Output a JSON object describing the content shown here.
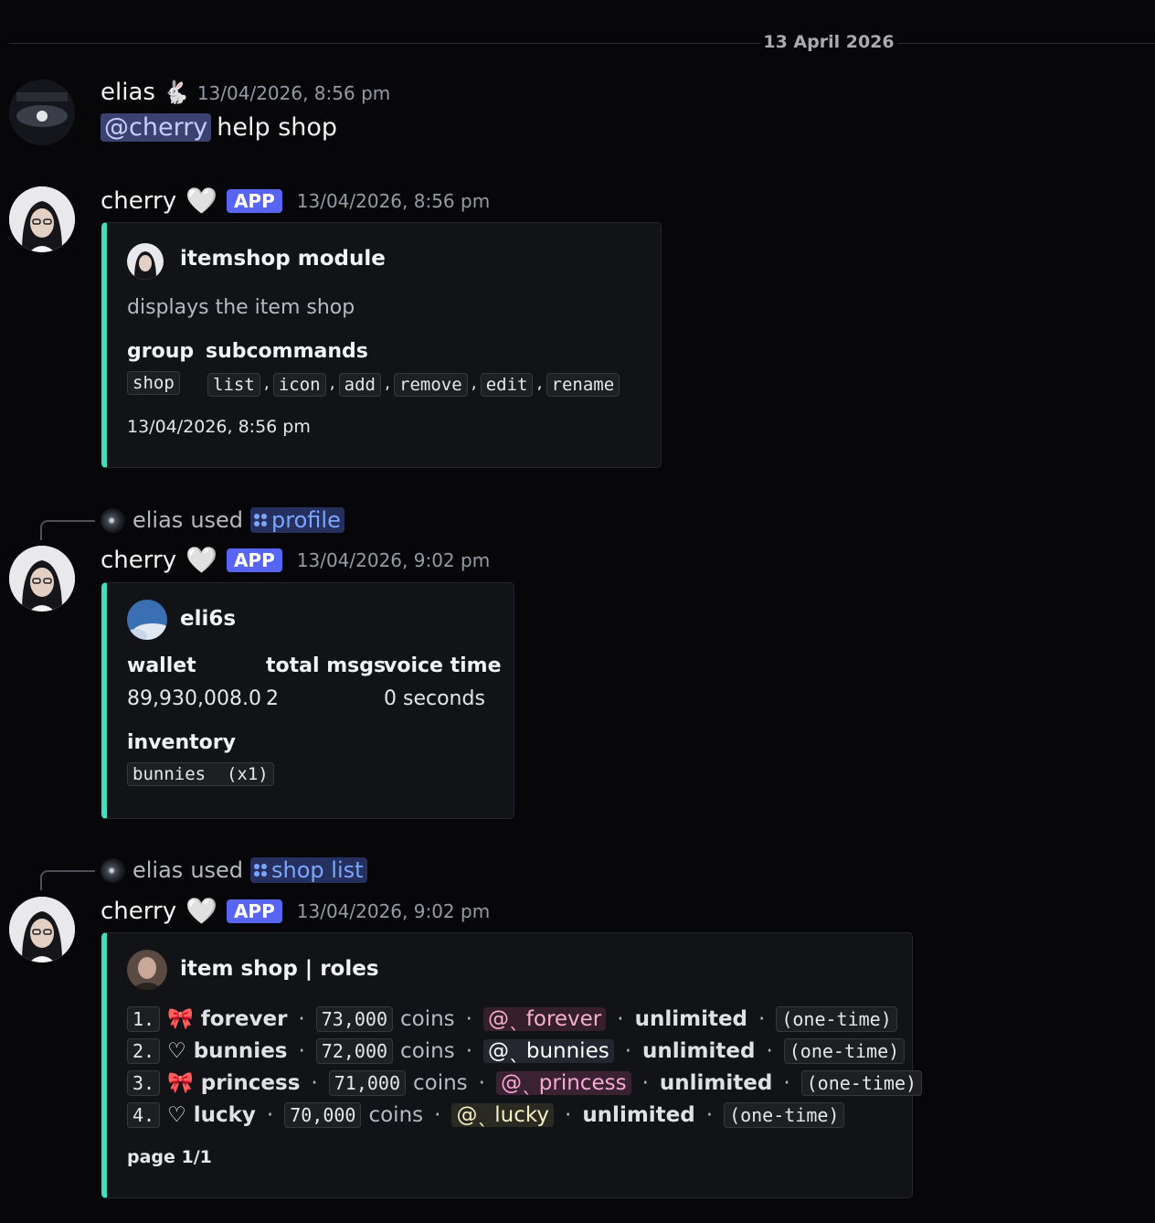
{
  "divider": {
    "date": "13 April 2026"
  },
  "messages": [
    {
      "author": "elias",
      "author_badge": "bunny-emoji",
      "timestamp": "13/04/2026, 8:56 pm",
      "mention": "@cherry",
      "text": "help shop"
    },
    {
      "author": "cherry",
      "tag": "APP",
      "timestamp": "13/04/2026, 8:56 pm",
      "embed": {
        "title": "itemshop module",
        "description": "displays the item shop",
        "group_label": "group",
        "subcommands_label": "subcommands",
        "group_value": "shop",
        "subcommands": [
          "list",
          "icon",
          "add",
          "remove",
          "edit",
          "rename"
        ],
        "footer": "13/04/2026, 8:56 pm"
      }
    },
    {
      "used_by": "elias",
      "used_text": "used",
      "command": "profile",
      "author": "cherry",
      "tag": "APP",
      "timestamp": "13/04/2026, 9:02 pm",
      "embed": {
        "title": "eli6s",
        "fields": [
          {
            "name": "wallet",
            "value": "89,930,008.0"
          },
          {
            "name": "total msgs",
            "value": "2"
          },
          {
            "name": "voice time",
            "value": "0 seconds"
          }
        ],
        "inventory_label": "inventory",
        "inventory_item": "bunnies  (x1)"
      }
    },
    {
      "used_by": "elias",
      "used_text": "used",
      "command": "shop list",
      "author": "cherry",
      "tag": "APP",
      "timestamp": "13/04/2026, 9:02 pm",
      "embed": {
        "title": "item shop | roles",
        "items": [
          {
            "num": "1.",
            "icon": "bow-emoji",
            "name": "forever",
            "price": "73,000",
            "coins": "coins",
            "role": "@ˎ forever",
            "stock": "unlimited",
            "type": "(one-time)"
          },
          {
            "num": "2.",
            "icon": "heart-outline-icon",
            "name": "bunnies",
            "price": "72,000",
            "coins": "coins",
            "role": "@ˎ bunnies",
            "stock": "unlimited",
            "type": "(one-time)"
          },
          {
            "num": "3.",
            "icon": "bow-emoji",
            "name": "princess",
            "price": "71,000",
            "coins": "coins",
            "role": "@ˎ princess",
            "stock": "unlimited",
            "type": "(one-time)"
          },
          {
            "num": "4.",
            "icon": "heart-outline-icon",
            "name": "lucky",
            "price": "70,000",
            "coins": "coins",
            "role": "@ˎ lucky",
            "stock": "unlimited",
            "type": "(one-time)"
          }
        ],
        "footer": "page 1/1"
      }
    }
  ],
  "colors": {
    "accent": "#45ddc0",
    "app_tag": "#5865f2",
    "mention": "#3c4270",
    "command": "#7aa6ff"
  }
}
